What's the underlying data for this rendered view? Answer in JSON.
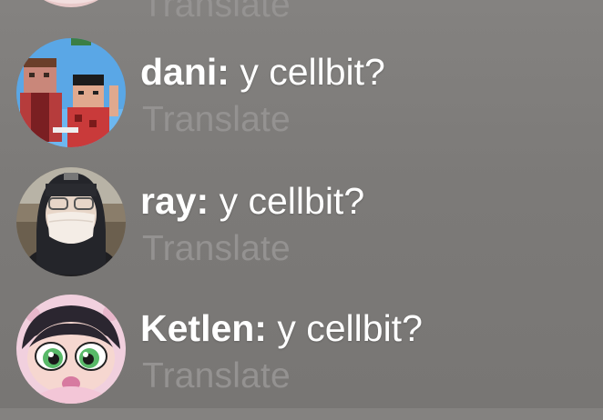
{
  "comments": [
    {
      "username": "",
      "message": "",
      "translate_label": "Translate",
      "avatar_icon": "pink-avatar-icon"
    },
    {
      "username": "dani:",
      "message": " y cellbit?",
      "translate_label": "Translate",
      "avatar_icon": "minecraft-skin-avatar-icon"
    },
    {
      "username": "ray:",
      "message": " y cellbit?",
      "translate_label": "Translate",
      "avatar_icon": "masked-person-avatar-icon"
    },
    {
      "username": "Ketlen:",
      "message": " y cellbit?",
      "translate_label": "Translate",
      "avatar_icon": "cartoon-girl-avatar-icon"
    }
  ],
  "colors": {
    "background": "#7f7d7b",
    "text": "#ffffff",
    "translate": "#969492"
  }
}
